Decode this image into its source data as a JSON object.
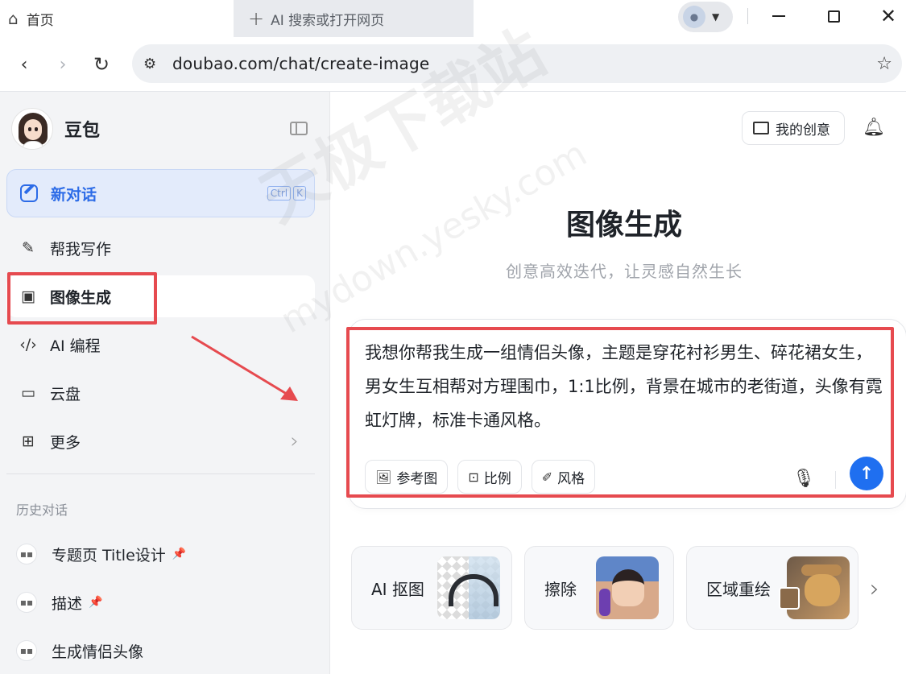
{
  "browser": {
    "home_tab_label": "首页",
    "new_tab_label": "AI 搜索或打开网页",
    "url": "doubao.com/chat/create-image"
  },
  "sidebar": {
    "brand_name": "豆包",
    "new_chat_label": "新对话",
    "shortcut_keys": [
      "Ctrl",
      "K"
    ],
    "items": [
      {
        "label": "帮我写作",
        "icon": "pen-sparkle-icon"
      },
      {
        "label": "图像生成",
        "icon": "image-sparkle-icon",
        "active": true
      },
      {
        "label": "AI 编程",
        "icon": "code-icon"
      },
      {
        "label": "云盘",
        "icon": "cloud-folder-icon"
      },
      {
        "label": "更多",
        "icon": "grid-plus-icon"
      }
    ],
    "history_title": "历史对话",
    "history": [
      {
        "label": "专题页 Title设计",
        "pinned": true
      },
      {
        "label": "描述",
        "pinned": true
      },
      {
        "label": "生成情侣头像",
        "pinned": false
      }
    ]
  },
  "main": {
    "my_creations_label": "我的创意",
    "title": "图像生成",
    "subtitle": "创意高效迭代，让灵感自然生长",
    "prompt_text": "我想你帮我生成一组情侣头像，主题是穿花衬衫男生、碎花裙女生，男女生互相帮对方理围巾，1:1比例，背景在城市的老街道，头像有霓虹灯牌，标准卡通风格。",
    "tools": [
      {
        "label": "参考图",
        "icon": "image-add-icon"
      },
      {
        "label": "比例",
        "icon": "aspect-ratio-icon"
      },
      {
        "label": "风格",
        "icon": "brush-icon"
      }
    ],
    "feature_cards": [
      {
        "label": "AI 抠图"
      },
      {
        "label": "擦除"
      },
      {
        "label": "区域重绘"
      }
    ]
  },
  "watermark": {
    "text1": "天极下载站",
    "text2": "mydown.yesky.com"
  },
  "colors": {
    "accent": "#2c6be7",
    "send_button": "#1f6ff0",
    "annotation_red": "#e64a4f"
  }
}
